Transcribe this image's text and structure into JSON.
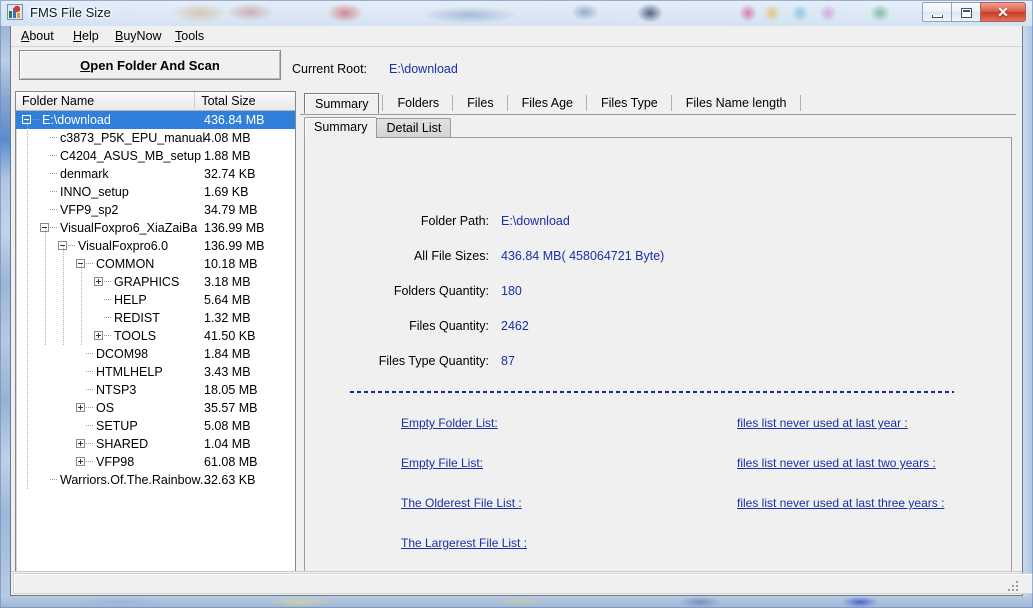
{
  "window": {
    "title": "FMS File Size",
    "app_icon": "chart-app-icon",
    "minimize_label": "Minimize",
    "maximize_label": "Maximize",
    "close_label": "Close"
  },
  "menu": [
    {
      "label": "About",
      "accel": "A"
    },
    {
      "label": "Help",
      "accel": "H"
    },
    {
      "label": "BuyNow",
      "accel": "B"
    },
    {
      "label": "Tools",
      "accel": "T"
    }
  ],
  "toolbar": {
    "scan_button": "Open Folder And Scan",
    "scan_button_accel": "O",
    "current_root_label": "Current Root:",
    "current_root_value": "E:\\download"
  },
  "tree": {
    "columns": [
      "Folder Name",
      "Total Size"
    ],
    "rows": [
      {
        "name": "E:\\download",
        "size": "436.84 MB",
        "depth": 0,
        "toggle": "minus",
        "selected": true
      },
      {
        "name": "c3873_P5K_EPU_manual",
        "size": "4.08 MB",
        "depth": 1,
        "toggle": "none",
        "selected": false
      },
      {
        "name": "C4204_ASUS_MB_setup",
        "size": "1.88 MB",
        "depth": 1,
        "toggle": "none",
        "selected": false
      },
      {
        "name": "denmark",
        "size": "32.74 KB",
        "depth": 1,
        "toggle": "none",
        "selected": false
      },
      {
        "name": "INNO_setup",
        "size": "1.69 KB",
        "depth": 1,
        "toggle": "none",
        "selected": false
      },
      {
        "name": "VFP9_sp2",
        "size": "34.79 MB",
        "depth": 1,
        "toggle": "none",
        "selected": false
      },
      {
        "name": "VisualFoxpro6_XiaZaiBa",
        "size": "136.99 MB",
        "depth": 1,
        "toggle": "minus",
        "selected": false
      },
      {
        "name": "VisualFoxpro6.0",
        "size": "136.99 MB",
        "depth": 2,
        "toggle": "minus",
        "selected": false
      },
      {
        "name": "COMMON",
        "size": "10.18 MB",
        "depth": 3,
        "toggle": "minus",
        "selected": false
      },
      {
        "name": "GRAPHICS",
        "size": "3.18 MB",
        "depth": 4,
        "toggle": "plus",
        "selected": false
      },
      {
        "name": "HELP",
        "size": "5.64 MB",
        "depth": 4,
        "toggle": "none",
        "selected": false
      },
      {
        "name": "REDIST",
        "size": "1.32 MB",
        "depth": 4,
        "toggle": "none",
        "selected": false
      },
      {
        "name": "TOOLS",
        "size": "41.50 KB",
        "depth": 4,
        "toggle": "plus",
        "selected": false
      },
      {
        "name": "DCOM98",
        "size": "1.84 MB",
        "depth": 3,
        "toggle": "none",
        "selected": false
      },
      {
        "name": "HTMLHELP",
        "size": "3.43 MB",
        "depth": 3,
        "toggle": "none",
        "selected": false
      },
      {
        "name": "NTSP3",
        "size": "18.05 MB",
        "depth": 3,
        "toggle": "none",
        "selected": false
      },
      {
        "name": "OS",
        "size": "35.57 MB",
        "depth": 3,
        "toggle": "plus",
        "selected": false
      },
      {
        "name": "SETUP",
        "size": "5.08 MB",
        "depth": 3,
        "toggle": "none",
        "selected": false
      },
      {
        "name": "SHARED",
        "size": "1.04 MB",
        "depth": 3,
        "toggle": "plus",
        "selected": false
      },
      {
        "name": "VFP98",
        "size": "61.08 MB",
        "depth": 3,
        "toggle": "plus",
        "selected": false
      },
      {
        "name": "Warriors.Of.The.Rainbow...",
        "size": "32.63 KB",
        "depth": 1,
        "toggle": "none",
        "selected": false
      }
    ]
  },
  "tabs": {
    "main": [
      {
        "label": "Summary",
        "active": true
      },
      {
        "label": "Folders",
        "active": false
      },
      {
        "label": "Files",
        "active": false
      },
      {
        "label": "Files Age",
        "active": false
      },
      {
        "label": "Files Type",
        "active": false
      },
      {
        "label": "Files Name length",
        "active": false
      }
    ],
    "sub": [
      {
        "label": "Summary",
        "active": true
      },
      {
        "label": "Detail List",
        "active": false
      }
    ]
  },
  "summary": {
    "fields": [
      {
        "label": "Folder Path:",
        "value": "E:\\download"
      },
      {
        "label": "All File Sizes:",
        "value": "436.84 MB( 458064721 Byte)"
      },
      {
        "label": "Folders Quantity:",
        "value": "180"
      },
      {
        "label": "Files Quantity:",
        "value": "2462"
      },
      {
        "label": "Files Type Quantity:",
        "value": "87"
      }
    ],
    "links_left": [
      "Empty Folder List:",
      "Empty File List:",
      "The Olderest File List :",
      "The Largerest File List :"
    ],
    "links_right": [
      "files list never used at last year :",
      "files list never used at last two years :",
      "files list never used at last three years :"
    ]
  },
  "statusbar": {
    "panel1": "",
    "panel2": ""
  },
  "colors": {
    "link": "#1a2fa8",
    "selection": "#2f7fdb",
    "face": "#f0f0f0"
  }
}
